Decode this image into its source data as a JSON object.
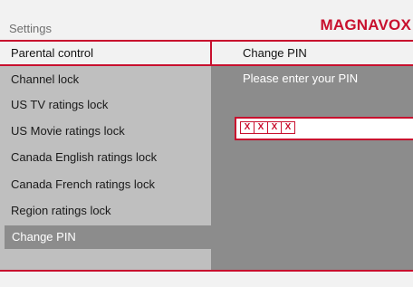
{
  "header": {
    "section_title": "Settings",
    "brand": "MAGNAVOX"
  },
  "breadcrumb": {
    "left": "Parental control",
    "right": "Change PIN"
  },
  "menu": {
    "items": [
      {
        "label": "Channel lock"
      },
      {
        "label": "US TV ratings lock"
      },
      {
        "label": "US Movie ratings lock"
      },
      {
        "label": "Canada English ratings lock"
      },
      {
        "label": "Canada French ratings lock"
      },
      {
        "label": "Region ratings lock"
      },
      {
        "label": "Change PIN"
      }
    ],
    "selected_index": 6
  },
  "pin_dialog": {
    "prompt": "Please enter your PIN",
    "digits": [
      "X",
      "X",
      "X",
      "X"
    ]
  },
  "colors": {
    "accent": "#c8102e",
    "left_panel": "#bfbfbf",
    "right_panel": "#8c8c8c",
    "chrome": "#f2f2f2"
  }
}
